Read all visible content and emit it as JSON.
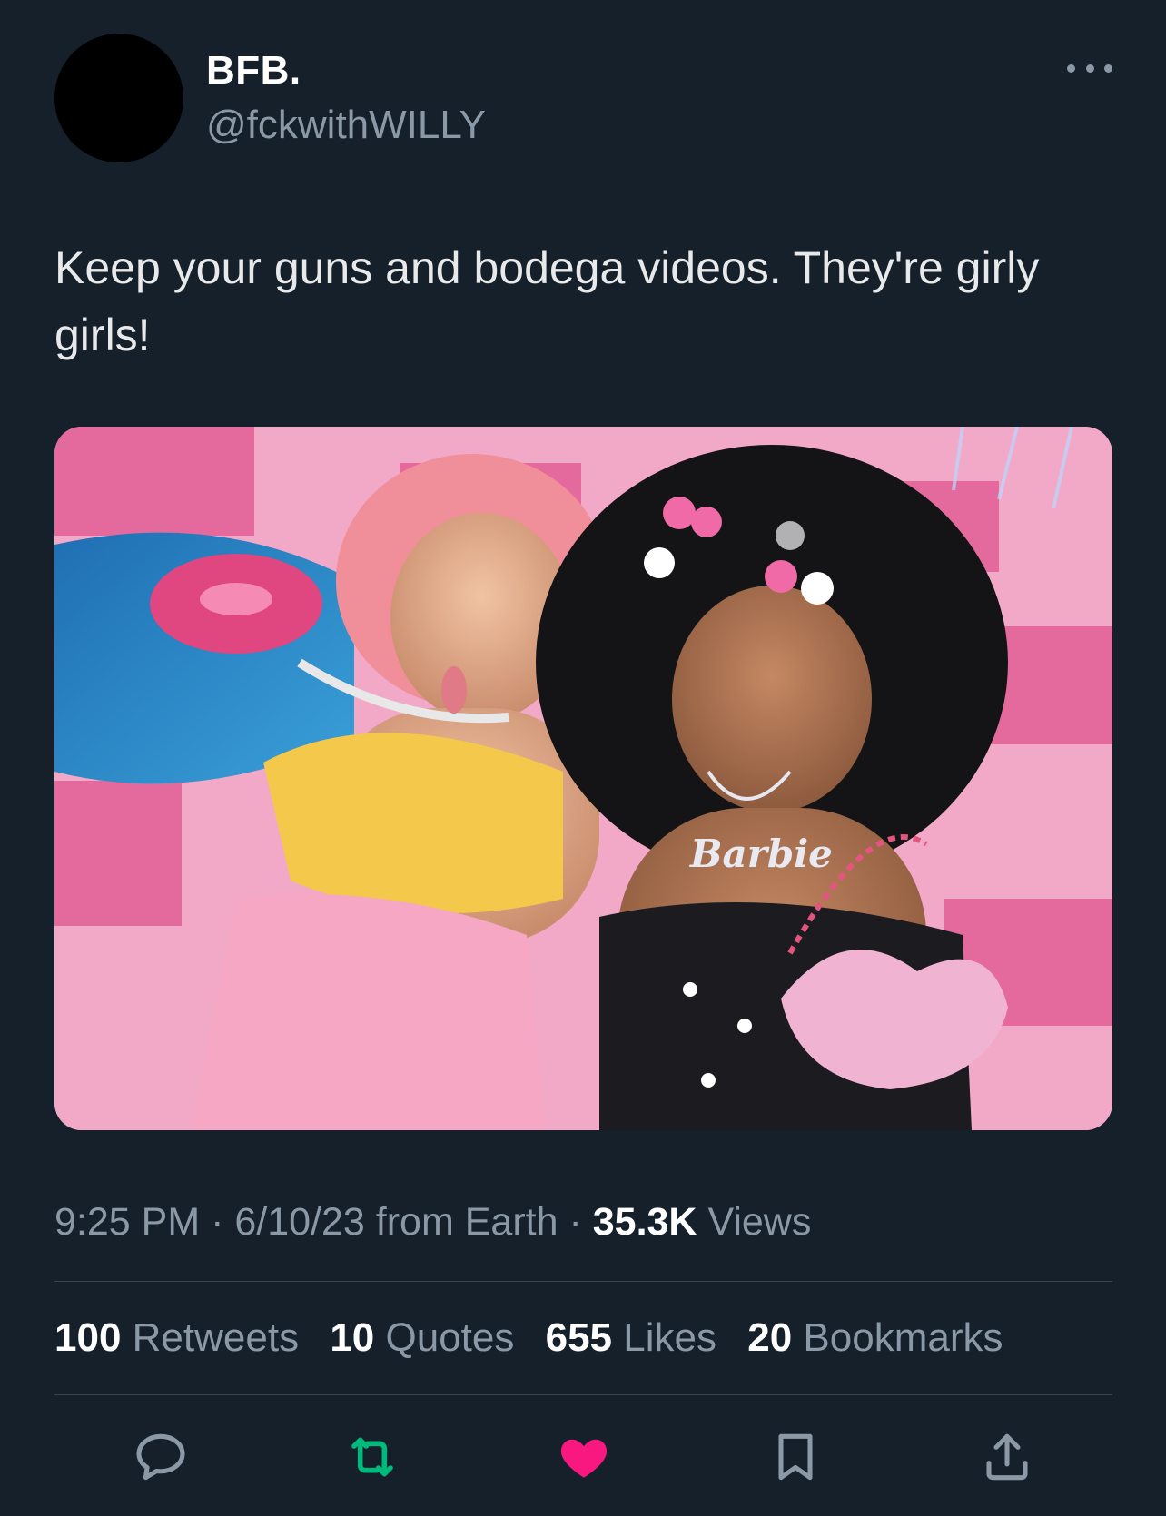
{
  "author": {
    "name": "BFB.",
    "handle": "@fckwithWILLY"
  },
  "tweet": {
    "text": "Keep your guns and bodega videos. They're girly girls!"
  },
  "media": {
    "necklace_text": "Barbie"
  },
  "meta": {
    "time": "9:25 PM",
    "separator": " · ",
    "date": "6/10/23",
    "source": "from Earth",
    "views_count": "35.3K",
    "views_label": "Views"
  },
  "stats": [
    {
      "count": "100",
      "label": "Retweets"
    },
    {
      "count": "10",
      "label": "Quotes"
    },
    {
      "count": "655",
      "label": "Likes"
    },
    {
      "count": "20",
      "label": "Bookmarks"
    }
  ],
  "actions": {
    "reply_icon": "reply-icon",
    "retweet_icon": "retweet-icon",
    "like_icon": "heart-icon",
    "bookmark_icon": "bookmark-icon",
    "share_icon": "share-icon"
  },
  "colors": {
    "background": "#15202b",
    "muted_text": "#8b98a5",
    "divider": "#38444d",
    "retweet_active": "#00ba7c",
    "like_active": "#f91880"
  }
}
